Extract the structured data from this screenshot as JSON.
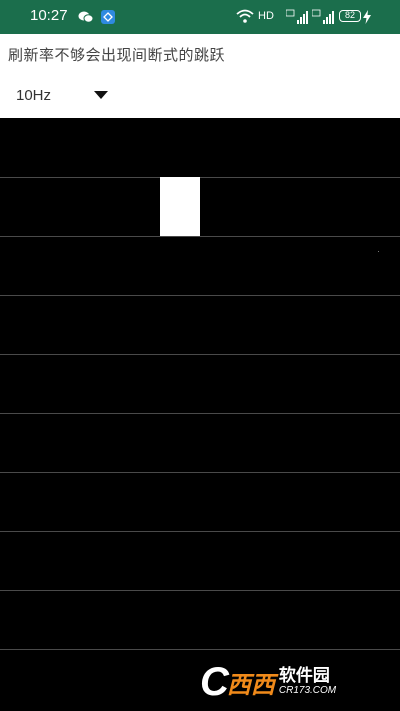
{
  "status_bar": {
    "time": "10:27",
    "network_label": "HD",
    "battery_level": "82",
    "icons": [
      "wechat-icon",
      "app-notification-icon",
      "wifi-icon",
      "signal-icon",
      "signal-icon",
      "battery-icon",
      "charging-icon"
    ]
  },
  "header": {
    "title": "刷新率不够会出现间断式的跳跃",
    "rate_select": {
      "selected": "10Hz",
      "icon": "dropdown-arrow-icon"
    }
  },
  "canvas": {
    "background": "#000000",
    "block_color": "#ffffff",
    "grid_rows": 10
  },
  "watermark": {
    "logo_letter": "C",
    "logo_text": "西西",
    "brand": "软件园",
    "url": "CR173.COM"
  },
  "colors": {
    "status_bar": "#1b6e4c",
    "header_bg": "#ffffff",
    "watermark_accent": "#f08a1a"
  }
}
